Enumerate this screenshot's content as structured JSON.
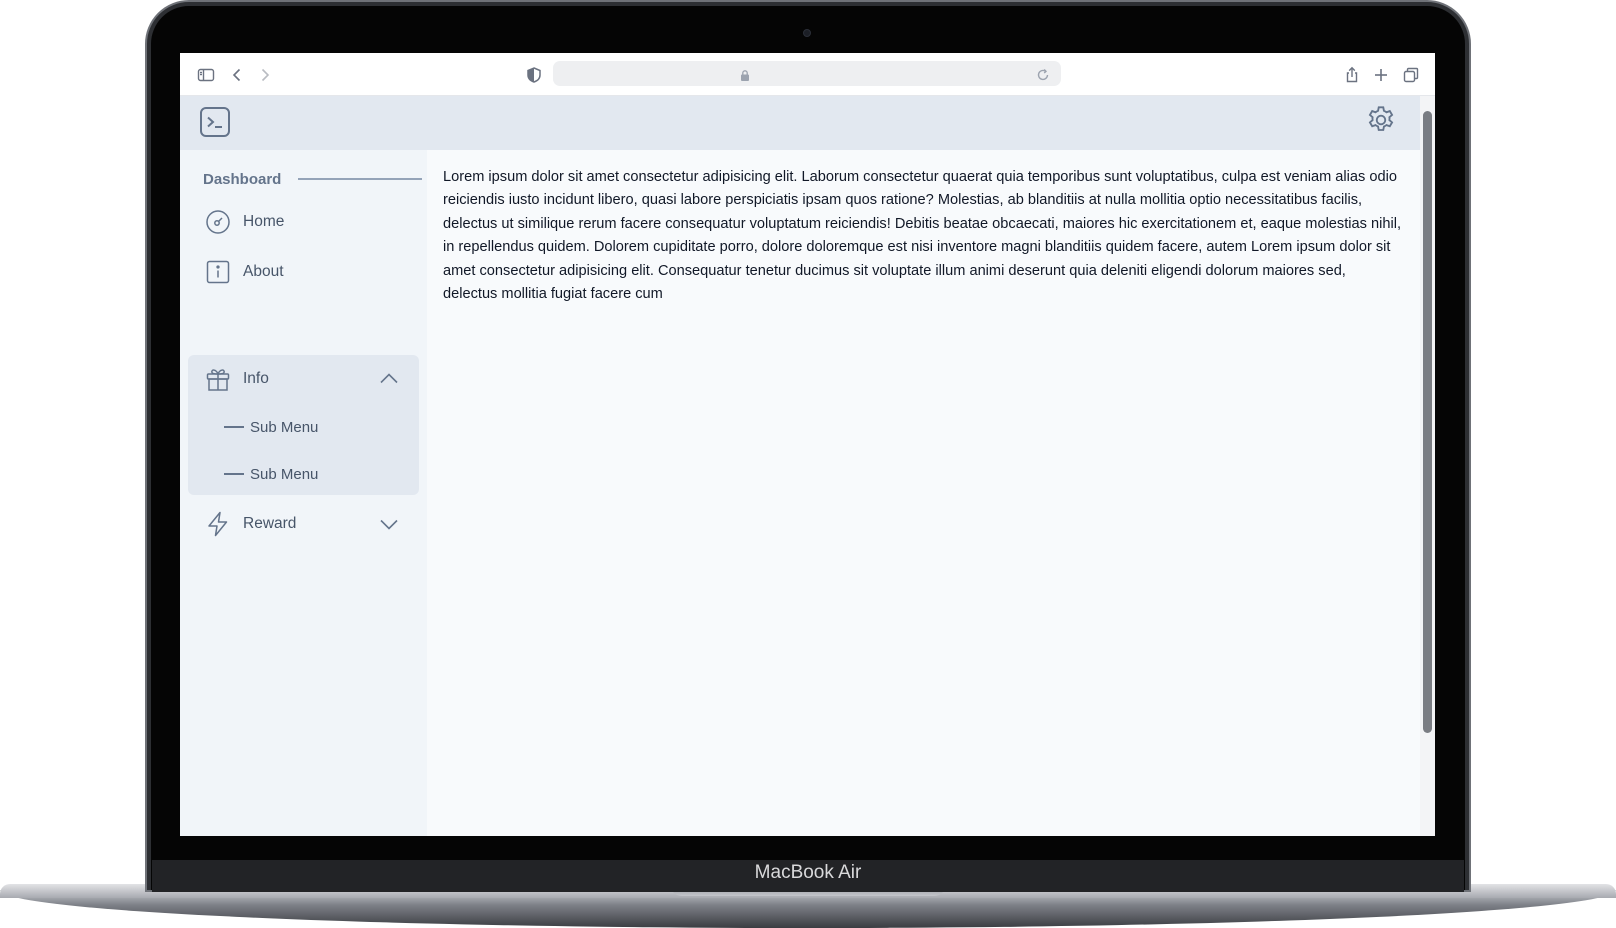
{
  "device": {
    "label": "MacBook Air"
  },
  "browser": {
    "icons": [
      "sidebar-toggle-icon",
      "back-icon",
      "forward-icon",
      "shield-icon",
      "lock-icon",
      "reload-icon",
      "share-icon",
      "plus-icon",
      "tabs-icon"
    ]
  },
  "header": {
    "logo_icon": "terminal-icon",
    "settings_icon": "gear-icon"
  },
  "sidebar": {
    "section_title": "Dashboard",
    "items": [
      {
        "label": "Home",
        "icon": "gauge-icon"
      },
      {
        "label": "About",
        "icon": "info-icon"
      },
      {
        "label": "Info",
        "icon": "gift-icon",
        "expanded": true,
        "children": [
          {
            "label": "Sub Menu"
          },
          {
            "label": "Sub Menu"
          }
        ]
      },
      {
        "label": "Reward",
        "icon": "lightning-icon",
        "expanded": false
      }
    ]
  },
  "main": {
    "text": "Lorem ipsum dolor sit amet consectetur adipisicing elit. Laborum consectetur quaerat quia temporibus sunt voluptatibus, culpa est veniam alias odio reiciendis iusto incidunt libero, quasi labore perspiciatis ipsam quos ratione? Molestias, ab blanditiis at nulla mollitia optio necessitatibus facilis, delectus ut similique rerum facere consequatur voluptatum reiciendis! Debitis beatae obcaecati, maiores hic exercitationem et, eaque molestias nihil, in repellendus quidem. Dolorem cupiditate porro, dolore doloremque est nisi inventore magni blanditiis quidem facere, autem Lorem ipsum dolor sit amet consectetur adipisicing elit. Consequatur tenetur ducimus sit voluptate illum animi deserunt quia deleniti eligendi dolorum maiores sed, delectus mollitia fugiat facere cum"
  },
  "colors": {
    "header_bg": "#e2e8f0",
    "sidebar_bg": "#f1f5f9",
    "content_bg": "#f8fafc",
    "icon": "#64748b"
  }
}
